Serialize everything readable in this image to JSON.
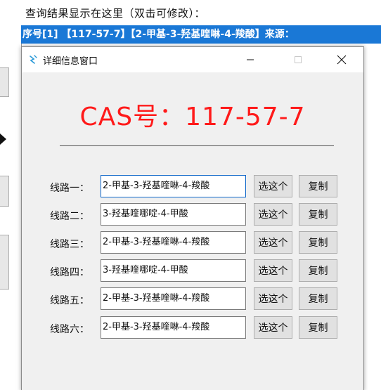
{
  "background": {
    "heading": "查询结果显示在这里（双击可修改）：",
    "result_row": "序号[1] 【117-57-7】【2-甲基-3-羟基喹啉-4-羧酸】来源："
  },
  "dialog": {
    "title": "详细信息窗口",
    "icon": "app-icon",
    "cas_title": "CAS号：117-57-7",
    "title_color": "#ff1a1a",
    "select_label": "选这个",
    "copy_label": "复制",
    "routes": [
      {
        "label": "线路一：",
        "value": "2-甲基-3-羟基喹啉-4-羧酸"
      },
      {
        "label": "线路二：",
        "value": "3-羟基喹哪啶-4-甲酸"
      },
      {
        "label": "线路三：",
        "value": "2-甲基-3-羟基喹啉-4-羧酸"
      },
      {
        "label": "线路四：",
        "value": "3-羟基喹哪啶-4-甲酸"
      },
      {
        "label": "线路五：",
        "value": "2-甲基-3-羟基喹啉-4-羧酸"
      },
      {
        "label": "线路六：",
        "value": "2-甲基-3-羟基喹啉-4-羧酸"
      }
    ]
  },
  "colors": {
    "selection": "#1a78d6",
    "cas_red": "#ff1a1a"
  }
}
